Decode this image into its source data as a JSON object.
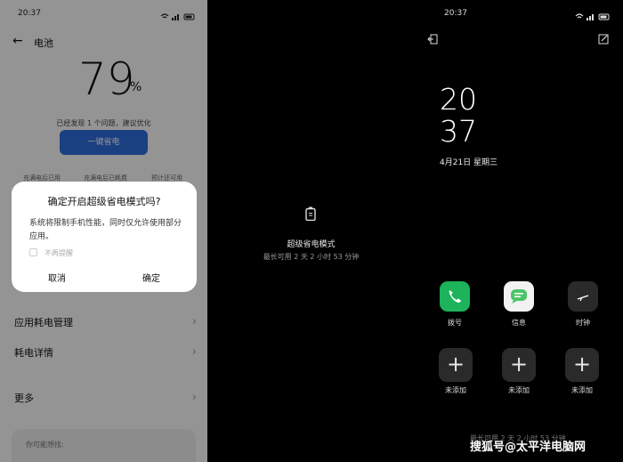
{
  "left": {
    "status_time": "20:37",
    "title": "电池",
    "percent": "79",
    "percent_unit": "%",
    "problem_text": "已经发现 1 个问题，建议优化",
    "optimize_button": "一键省电",
    "stat_labels": [
      "充满电后已用",
      "充满电后已耗费",
      "预计还可用"
    ],
    "dialog": {
      "title": "确定开启超级省电模式吗?",
      "body": "系统将限制手机性能，同时仅允许使用部分应用。",
      "checkbox_label": "不再提醒",
      "cancel": "取消",
      "confirm": "确定"
    },
    "menu": [
      "应用耗电管理",
      "耗电详情",
      "更多"
    ],
    "suggestion": "你可能想找:"
  },
  "middle": {
    "title": "超级省电模式",
    "subtitle": "最长可用 2 天 2 小时 53 分钟"
  },
  "right": {
    "status_time": "20:37",
    "clock_hour": "20",
    "clock_minute": "37",
    "date": "4月21日  星期三",
    "apps": [
      "拨号",
      "信息",
      "时钟"
    ],
    "add_label": "未添加",
    "bottom_text": "最长可用 2 天 2 小时 53 分钟",
    "watermark": "搜狐号@太平洋电脑网"
  },
  "colors": {
    "accent_blue": "#2f6fe0",
    "phone_green": "#1cb35a",
    "message_green": "#4cc46a"
  },
  "icons": [
    "back-arrow-icon",
    "wifi-icon",
    "signal-icon",
    "battery-icon",
    "exit-icon",
    "edit-icon",
    "phone-icon",
    "message-icon",
    "clock-icon",
    "plus-icon",
    "chevron-right-icon"
  ]
}
